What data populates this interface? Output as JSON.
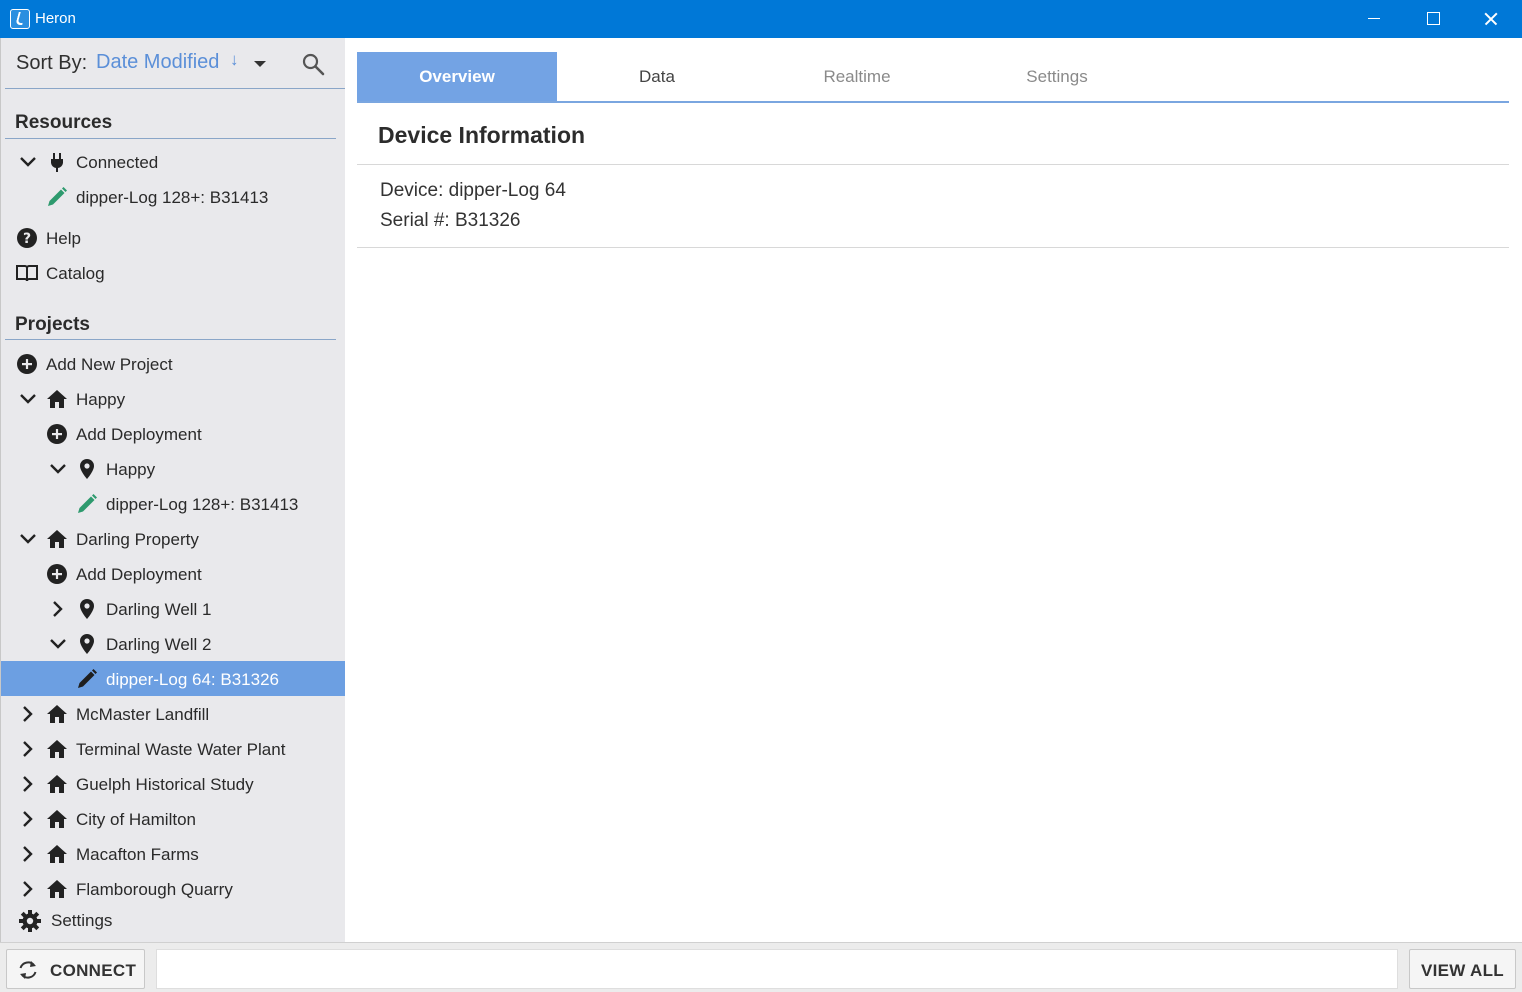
{
  "window": {
    "title": "Heron"
  },
  "sidebar": {
    "sort_label": "Sort By:",
    "sort_value": "Date Modified",
    "sort_direction_icon": "arrow-down-icon",
    "resources_title": "Resources",
    "resources": [
      {
        "label": "Connected",
        "icon": "plug-icon",
        "expanded": true
      },
      {
        "label": "dipper-Log 128+: B31413",
        "icon": "pencil-icon"
      },
      {
        "label": "Help",
        "icon": "help-icon"
      },
      {
        "label": "Catalog",
        "icon": "book-icon"
      }
    ],
    "projects_title": "Projects",
    "projects": [
      {
        "label": "Add New Project",
        "icon": "plus-circle-icon"
      },
      {
        "label": "Happy",
        "icon": "home-icon",
        "expanded": true
      },
      {
        "label": "Add Deployment",
        "icon": "plus-circle-icon"
      },
      {
        "label": "Happy",
        "icon": "location-pin-icon",
        "expanded": true
      },
      {
        "label": "dipper-Log 128+: B31413",
        "icon": "pencil-icon"
      },
      {
        "label": "Darling Property",
        "icon": "home-icon",
        "expanded": true
      },
      {
        "label": "Add Deployment",
        "icon": "plus-circle-icon"
      },
      {
        "label": "Darling Well 1",
        "icon": "location-pin-icon",
        "expanded": false
      },
      {
        "label": "Darling Well 2",
        "icon": "location-pin-icon",
        "expanded": true
      },
      {
        "label": "dipper-Log 64: B31326",
        "icon": "pencil-icon",
        "selected": true
      },
      {
        "label": "McMaster Landfill",
        "icon": "home-icon",
        "expanded": false
      },
      {
        "label": "Terminal Waste Water Plant",
        "icon": "home-icon",
        "expanded": false
      },
      {
        "label": "Guelph Historical Study",
        "icon": "home-icon",
        "expanded": false
      },
      {
        "label": "City of Hamilton",
        "icon": "home-icon",
        "expanded": false
      },
      {
        "label": "Macafton Farms",
        "icon": "home-icon",
        "expanded": false
      },
      {
        "label": "Flamborough Quarry",
        "icon": "home-icon",
        "expanded": false
      }
    ],
    "settings_label": "Settings"
  },
  "tabs": [
    {
      "label": "Overview",
      "active": true
    },
    {
      "label": "Data",
      "active": false
    },
    {
      "label": "Realtime",
      "active": false
    },
    {
      "label": "Settings",
      "active": false
    }
  ],
  "device_info": {
    "title": "Device Information",
    "device_line": "Device: dipper-Log 64",
    "serial_line": "Serial #: B31326"
  },
  "bottombar": {
    "connect_label": "CONNECT",
    "status_text": "",
    "view_all_label": "VIEW ALL"
  },
  "colors": {
    "titlebar": "#0078d7",
    "accent": "#6c9fe2",
    "sort_value": "#5b8fd8",
    "device_pencil_green": "#2e9a6e"
  }
}
